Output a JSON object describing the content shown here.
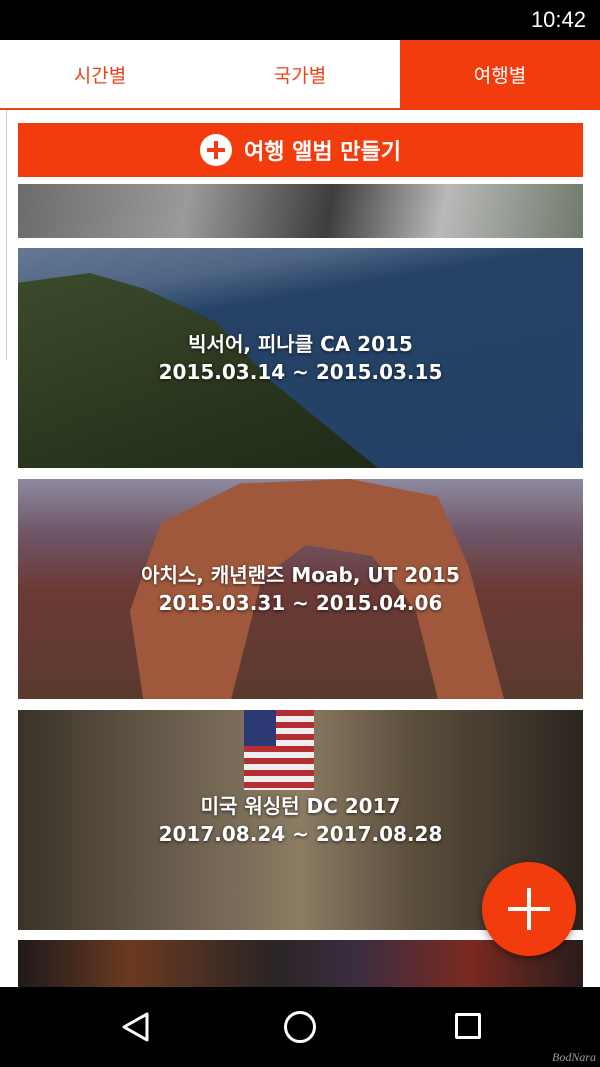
{
  "status_bar": {
    "time": "10:42"
  },
  "tabs": [
    {
      "label": "시간별",
      "active": false
    },
    {
      "label": "국가별",
      "active": false
    },
    {
      "label": "여행별",
      "active": true
    }
  ],
  "create_album": {
    "label": "여행 앨범 만들기",
    "icon": "plus-circle-icon"
  },
  "albums": [
    {
      "title": "빅서어, 피나클 CA 2015",
      "dates": "2015.03.14 ~ 2015.03.15"
    },
    {
      "title": "아치스, 캐년랜즈 Moab, UT 2015",
      "dates": "2015.03.31 ~ 2015.04.06"
    },
    {
      "title": "미국 워싱턴 DC 2017",
      "dates": "2017.08.24 ~ 2017.08.28"
    }
  ],
  "fab": {
    "icon": "plus-icon"
  },
  "nav_bar": {
    "icons": [
      "back-icon",
      "home-icon",
      "recents-icon"
    ]
  },
  "watermark": "BodNara",
  "colors": {
    "accent": "#f23c0e",
    "tab_text": "#e8441a"
  }
}
